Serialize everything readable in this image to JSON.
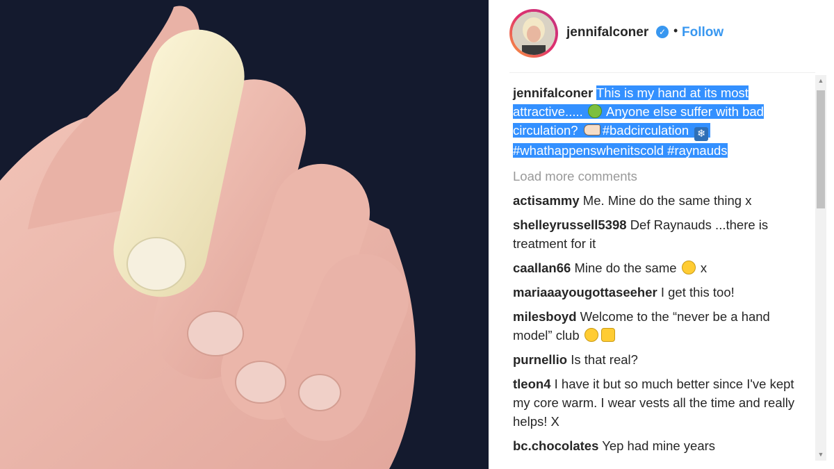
{
  "post": {
    "image_alt_icon": "hand-photo",
    "header": {
      "username": "jennifalconer",
      "verified_icon": "verified-badge-icon",
      "separator": "•",
      "follow_label": "Follow"
    },
    "caption": {
      "username": "jennifalconer",
      "text_1": "This is my hand at its most attractive.....",
      "text_2": "Anyone else suffer with bad circulation?",
      "hashtag_1": "#badcirculation",
      "hashtags_2": "#whathappenswhenitscold #raynauds"
    },
    "load_more_label": "Load more comments",
    "comments": [
      {
        "user": "actisammy",
        "text": "Me. Mine do the same thing x"
      },
      {
        "user": "shelleyrussell5398",
        "text": "Def Raynauds ...there is treatment for it"
      },
      {
        "user": "caallan66",
        "text": "Mine do the same",
        "suffix": "x"
      },
      {
        "user": "mariaaayougottaseeher",
        "text": "I get this too!"
      },
      {
        "user": "milesboyd",
        "text": "Welcome to the “never be a hand model” club"
      },
      {
        "user": "purnellio",
        "text": "Is that real?"
      },
      {
        "user": "tleon4",
        "text": "I have it but so much better since I've kept my core warm. I wear vests all the time and really helps! X"
      },
      {
        "user": "bc.chocolates",
        "text": "Yep had mine years"
      }
    ],
    "colors": {
      "accent": "#3897f0",
      "highlight": "#3390ff",
      "photo_bg": "#141a2e"
    }
  }
}
